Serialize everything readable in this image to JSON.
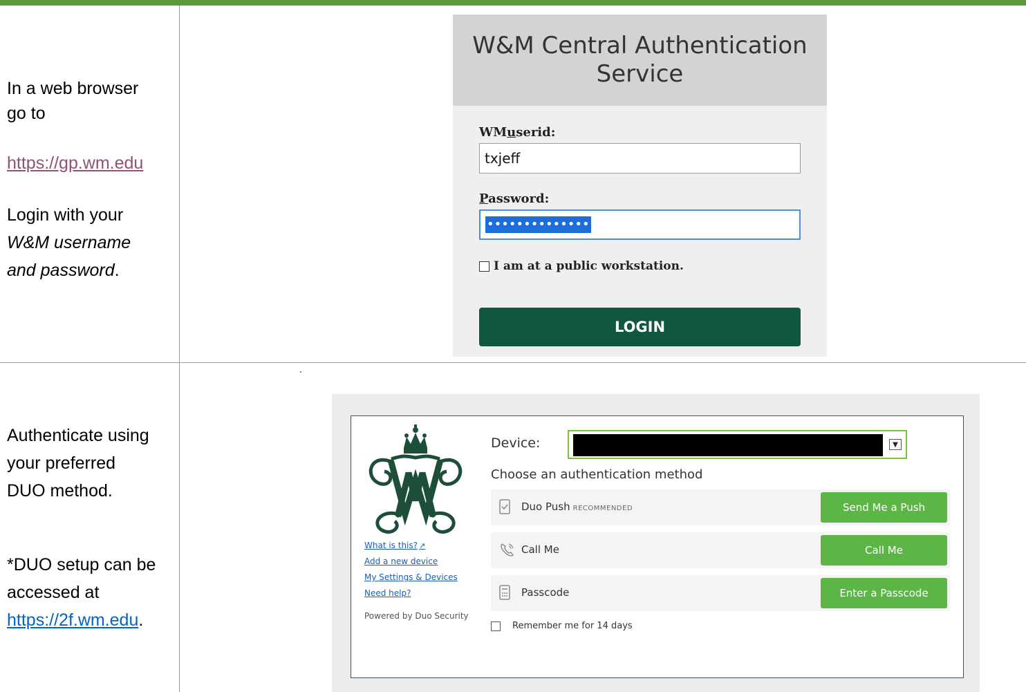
{
  "colors": {
    "topbar": "#5b9a35",
    "cas_button": "#115740",
    "duo_button": "#5cb646",
    "link": "#954f72"
  },
  "step1": {
    "line1": "In a web browser",
    "line2": "go to",
    "link": "https://gp.wm.edu",
    "line3": "Login with your",
    "line4": "W&M username",
    "line5a": "and password",
    "line5b": "."
  },
  "step2": {
    "line1": "Authenticate using",
    "line2": "your preferred",
    "line3": "DUO method.",
    "line4": "*DUO setup can be",
    "line5": "accessed at",
    "link": "https://2f.wm.edu",
    "link_suffix": "."
  },
  "cas": {
    "title": "W&M Central Authentication Service",
    "userid_label_pre": "WM",
    "userid_label_u": "u",
    "userid_label_post": "serid:",
    "userid_value": "txjeff",
    "password_label_p": "P",
    "password_label_post": "assword:",
    "password_value": "••••••••••••••",
    "public_checkbox": "I am at a public workstation.",
    "login_button": "LOGIN"
  },
  "duo": {
    "links": [
      "What is this?",
      "Add a new device",
      "My Settings & Devices",
      "Need help?"
    ],
    "powered": "Powered by Duo Security",
    "device_label": "Device:",
    "choose": "Choose an authentication method",
    "methods": [
      {
        "label": "Duo Push",
        "badge": "RECOMMENDED",
        "button": "Send Me a Push",
        "icon": "phone-check-icon"
      },
      {
        "label": "Call Me",
        "badge": "",
        "button": "Call Me",
        "icon": "phone-call-icon"
      },
      {
        "label": "Passcode",
        "badge": "",
        "button": "Enter a Passcode",
        "icon": "keypad-icon"
      }
    ],
    "remember": "Remember me for 14 days"
  }
}
